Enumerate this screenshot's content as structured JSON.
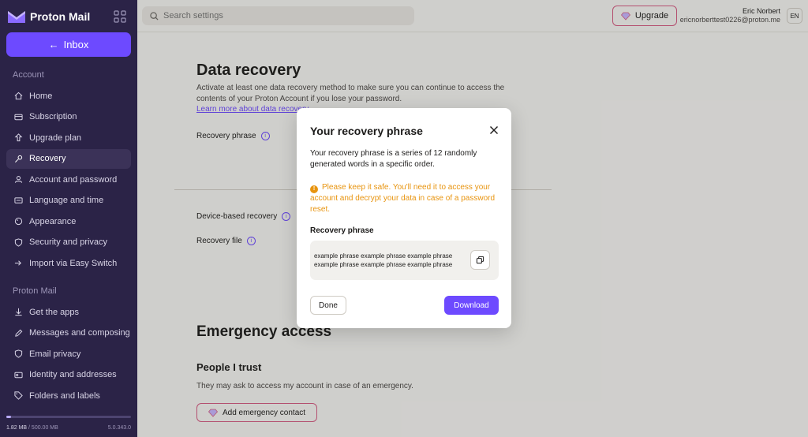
{
  "app": {
    "brand": "Proton Mail",
    "accent": "#6d4aff"
  },
  "sidebar": {
    "inbox_label": "Inbox",
    "account_section": "Account",
    "account_items": [
      {
        "label": "Home",
        "icon": "home-icon"
      },
      {
        "label": "Subscription",
        "icon": "credit-card-icon"
      },
      {
        "label": "Upgrade plan",
        "icon": "upgrade-icon"
      },
      {
        "label": "Recovery",
        "icon": "key-icon",
        "active": true
      },
      {
        "label": "Account and password",
        "icon": "user-icon"
      },
      {
        "label": "Language and time",
        "icon": "language-icon"
      },
      {
        "label": "Appearance",
        "icon": "paint-icon"
      },
      {
        "label": "Security and privacy",
        "icon": "shield-icon"
      },
      {
        "label": "Import via Easy Switch",
        "icon": "import-icon"
      }
    ],
    "mail_section": "Proton Mail",
    "mail_items": [
      {
        "label": "Get the apps",
        "icon": "download-icon"
      },
      {
        "label": "Messages and composing",
        "icon": "pen-icon"
      },
      {
        "label": "Email privacy",
        "icon": "shield-icon"
      },
      {
        "label": "Identity and addresses",
        "icon": "id-card-icon"
      },
      {
        "label": "Folders and labels",
        "icon": "tag-icon"
      }
    ],
    "storage_used": "1.82 MB",
    "storage_total": "/ 500.00 MB",
    "storage_fraction": 0.004,
    "version": "5.0.343.0"
  },
  "topbar": {
    "search_placeholder": "Search settings",
    "upgrade_label": "Upgrade",
    "user_name": "Eric Norbert",
    "user_email": "ericnorberttest0226@proton.me",
    "language": "EN"
  },
  "main": {
    "title": "Data recovery",
    "description": "Activate at least one data recovery method to make sure you can continue to access the contents of your Proton Account if you lose your password.",
    "learn_more": "Learn more about data recovery",
    "recovery_phrase_label": "Recovery phrase",
    "device_recovery_label": "Device-based recovery",
    "recovery_file_label": "Recovery file",
    "emergency_title": "Emergency access",
    "people_title": "People I trust",
    "people_desc": "They may ask to access my account in case of an emergency.",
    "add_contact_label": "Add emergency contact"
  },
  "modal": {
    "title": "Your recovery phrase",
    "description": "Your recovery phrase is a series of 12 randomly generated words in a specific order.",
    "warning": "Please keep it safe. You'll need it to access your account and decrypt your data in case of a password reset.",
    "phrase_label": "Recovery phrase",
    "phrase_line1": "example phrase example phrase example phrase",
    "phrase_line2": "example phrase example phrase example phrase",
    "done_label": "Done",
    "download_label": "Download"
  }
}
